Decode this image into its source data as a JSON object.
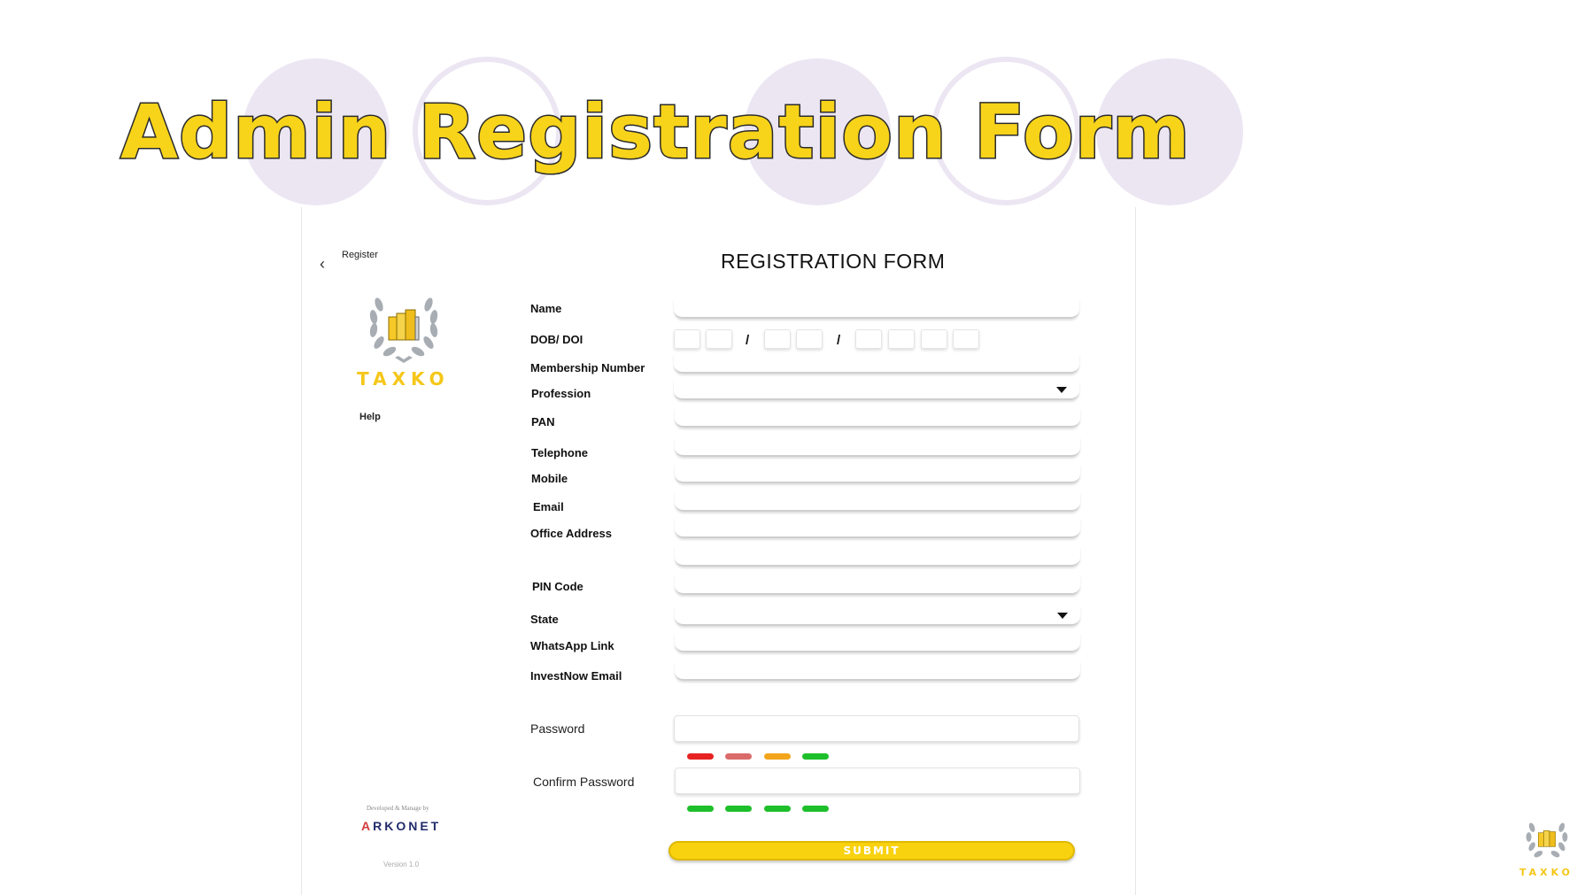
{
  "slide": {
    "title": "Admin Registration Form"
  },
  "app": {
    "breadcrumb": "Register",
    "brand": "TAXKO",
    "help": "Help",
    "developer_small": "Developed & Manage by",
    "developer_brand_a": "A",
    "developer_brand_rest": "RKONET",
    "version": "Version 1.0",
    "form_title": "REGISTRATION FORM",
    "fields": {
      "name": "Name",
      "dob": "DOB/ DOI",
      "membership": "Membership Number",
      "profession": "Profession",
      "pan": "PAN",
      "telephone": "Telephone",
      "mobile": "Mobile",
      "email": "Email",
      "office_address": "Office Address",
      "pin_code": "PIN Code",
      "state": "State",
      "whatsapp": "WhatsApp Link",
      "investnow_email": "InvestNow Email",
      "password": "Password",
      "confirm_password": "Confirm Password"
    },
    "date_separator": "/",
    "submit": "SUBMIT",
    "password_strength_colors": [
      "#e82222",
      "#db6b6b",
      "#f2a51c",
      "#1dbf2a"
    ],
    "confirm_strength_colors": [
      "#1dbf2a",
      "#1dbf2a",
      "#1dbf2a",
      "#1dbf2a"
    ],
    "accent_color": "#f9d20f"
  },
  "corner": {
    "brand": "TAXKO"
  }
}
